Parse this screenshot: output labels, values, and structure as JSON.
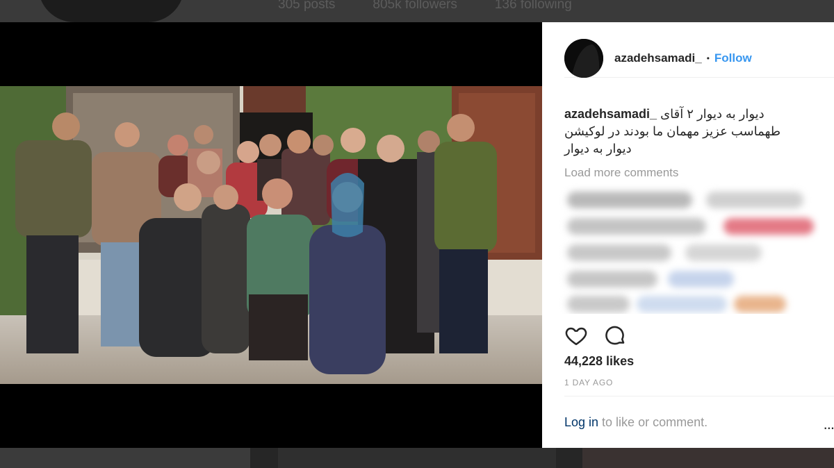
{
  "profile_bg": {
    "posts": "305 posts",
    "followers": "805k followers",
    "following": "136 following"
  },
  "post": {
    "username": "azadehsamadi_",
    "separator": "•",
    "follow_label": "Follow",
    "caption_lines": [
      "دیوار به دیوار ۲ آقای",
      "طهماسب عزیز مهمان ما بودند در لوکیشن",
      "دیوار به دیوار"
    ],
    "load_more": "Load more comments",
    "likes": "44,228 likes",
    "date": "1 DAY AGO",
    "login_link": "Log in",
    "login_text": " to like or comment.",
    "more_icon": "..."
  },
  "icons": {
    "like": "heart-icon",
    "comment": "comment-bubble-icon",
    "options": "more-options-icon"
  },
  "colors": {
    "follow_blue": "#3897f0",
    "link_dark_blue": "#003569",
    "muted_gray": "#999999",
    "text_dark": "#262626"
  }
}
